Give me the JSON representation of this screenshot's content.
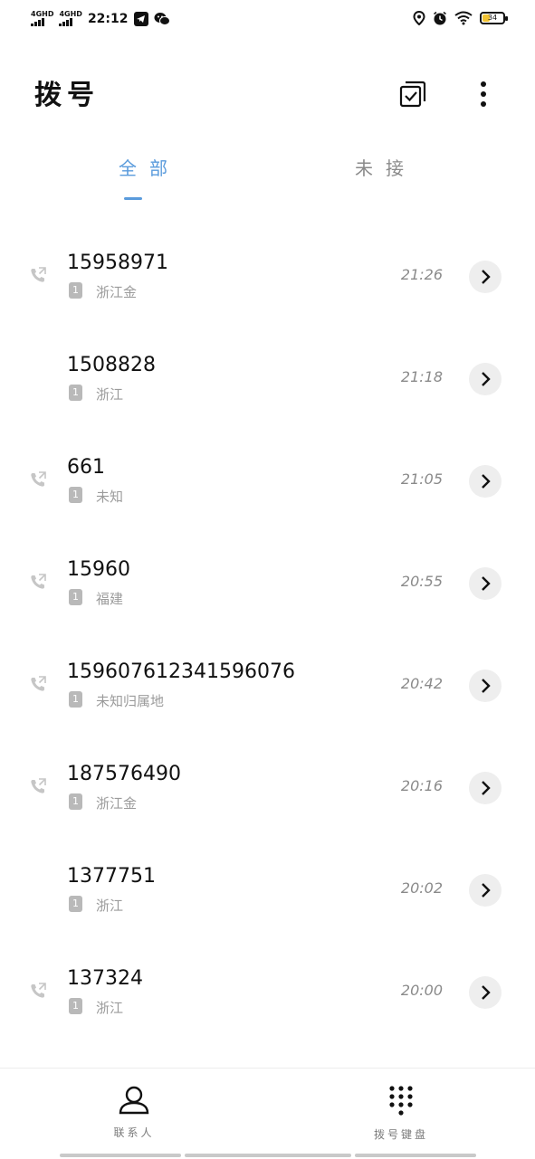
{
  "status_bar": {
    "network_1": "4GHD",
    "network_2": "4GHD",
    "time": "22:12",
    "battery_level": "34"
  },
  "header": {
    "title": "拨号"
  },
  "tabs": [
    {
      "label": "全部",
      "selected": true
    },
    {
      "label": "未接",
      "selected": false
    }
  ],
  "calls": [
    {
      "number": "15958971",
      "sim": "1",
      "location": "浙江金",
      "time": "21:26",
      "call_type_icon": "outgoing-call-icon"
    },
    {
      "number": "1508828",
      "sim": "1",
      "location": "浙江",
      "time": "21:18",
      "call_type_icon": ""
    },
    {
      "number": "661",
      "sim": "1",
      "location": "未知",
      "time": "21:05",
      "call_type_icon": "outgoing-call-icon"
    },
    {
      "number": "15960",
      "sim": "1",
      "location": "福建",
      "time": "20:55",
      "call_type_icon": "outgoing-call-icon"
    },
    {
      "number": "159607612341596076",
      "sim": "1",
      "location": "未知归属地",
      "time": "20:42",
      "call_type_icon": "outgoing-call-icon"
    },
    {
      "number": "187576490",
      "sim": "1",
      "location": "浙江金",
      "time": "20:16",
      "call_type_icon": "outgoing-call-icon"
    },
    {
      "number": "1377751",
      "sim": "1",
      "location": "浙江",
      "time": "20:02",
      "call_type_icon": ""
    },
    {
      "number": "137324",
      "sim": "1",
      "location": "浙江",
      "time": "20:00",
      "call_type_icon": "outgoing-call-icon"
    }
  ],
  "bottom_nav": {
    "contacts_label": "联系人",
    "dialpad_label": "拨号键盘"
  },
  "colors": {
    "accent": "#5a9bdc",
    "battery": "#f1c232"
  }
}
